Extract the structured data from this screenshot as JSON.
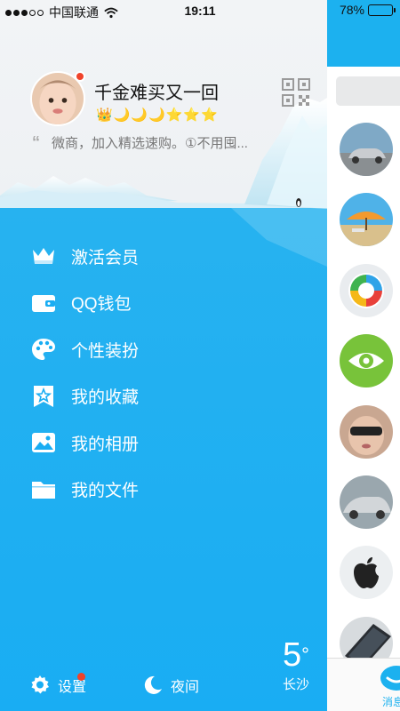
{
  "status_bar": {
    "carrier": "中国联通",
    "time": "19:11",
    "battery": "78%",
    "battery_level": 0.78
  },
  "profile": {
    "nickname": "千金难买又一回",
    "level_badges": "👑🌙🌙🌙⭐⭐⭐",
    "signature": "微商，加入精选速购。①不用囤..."
  },
  "menu": [
    {
      "label": "激活会员",
      "icon": "crown-icon"
    },
    {
      "label": "QQ钱包",
      "icon": "wallet-icon"
    },
    {
      "label": "个性装扮",
      "icon": "palette-icon"
    },
    {
      "label": "我的收藏",
      "icon": "favorites-icon"
    },
    {
      "label": "我的相册",
      "icon": "photo-album-icon"
    },
    {
      "label": "我的文件",
      "icon": "folder-icon"
    }
  ],
  "bottom": {
    "settings_label": "设置",
    "night_label": "夜间"
  },
  "weather": {
    "temperature": "5",
    "degree": "°",
    "city": "长沙"
  },
  "peek": {
    "tab_label": "消息"
  },
  "colors": {
    "accent": "#19adf3",
    "badge_red": "#f0432a",
    "gold": "#f4b21a"
  }
}
